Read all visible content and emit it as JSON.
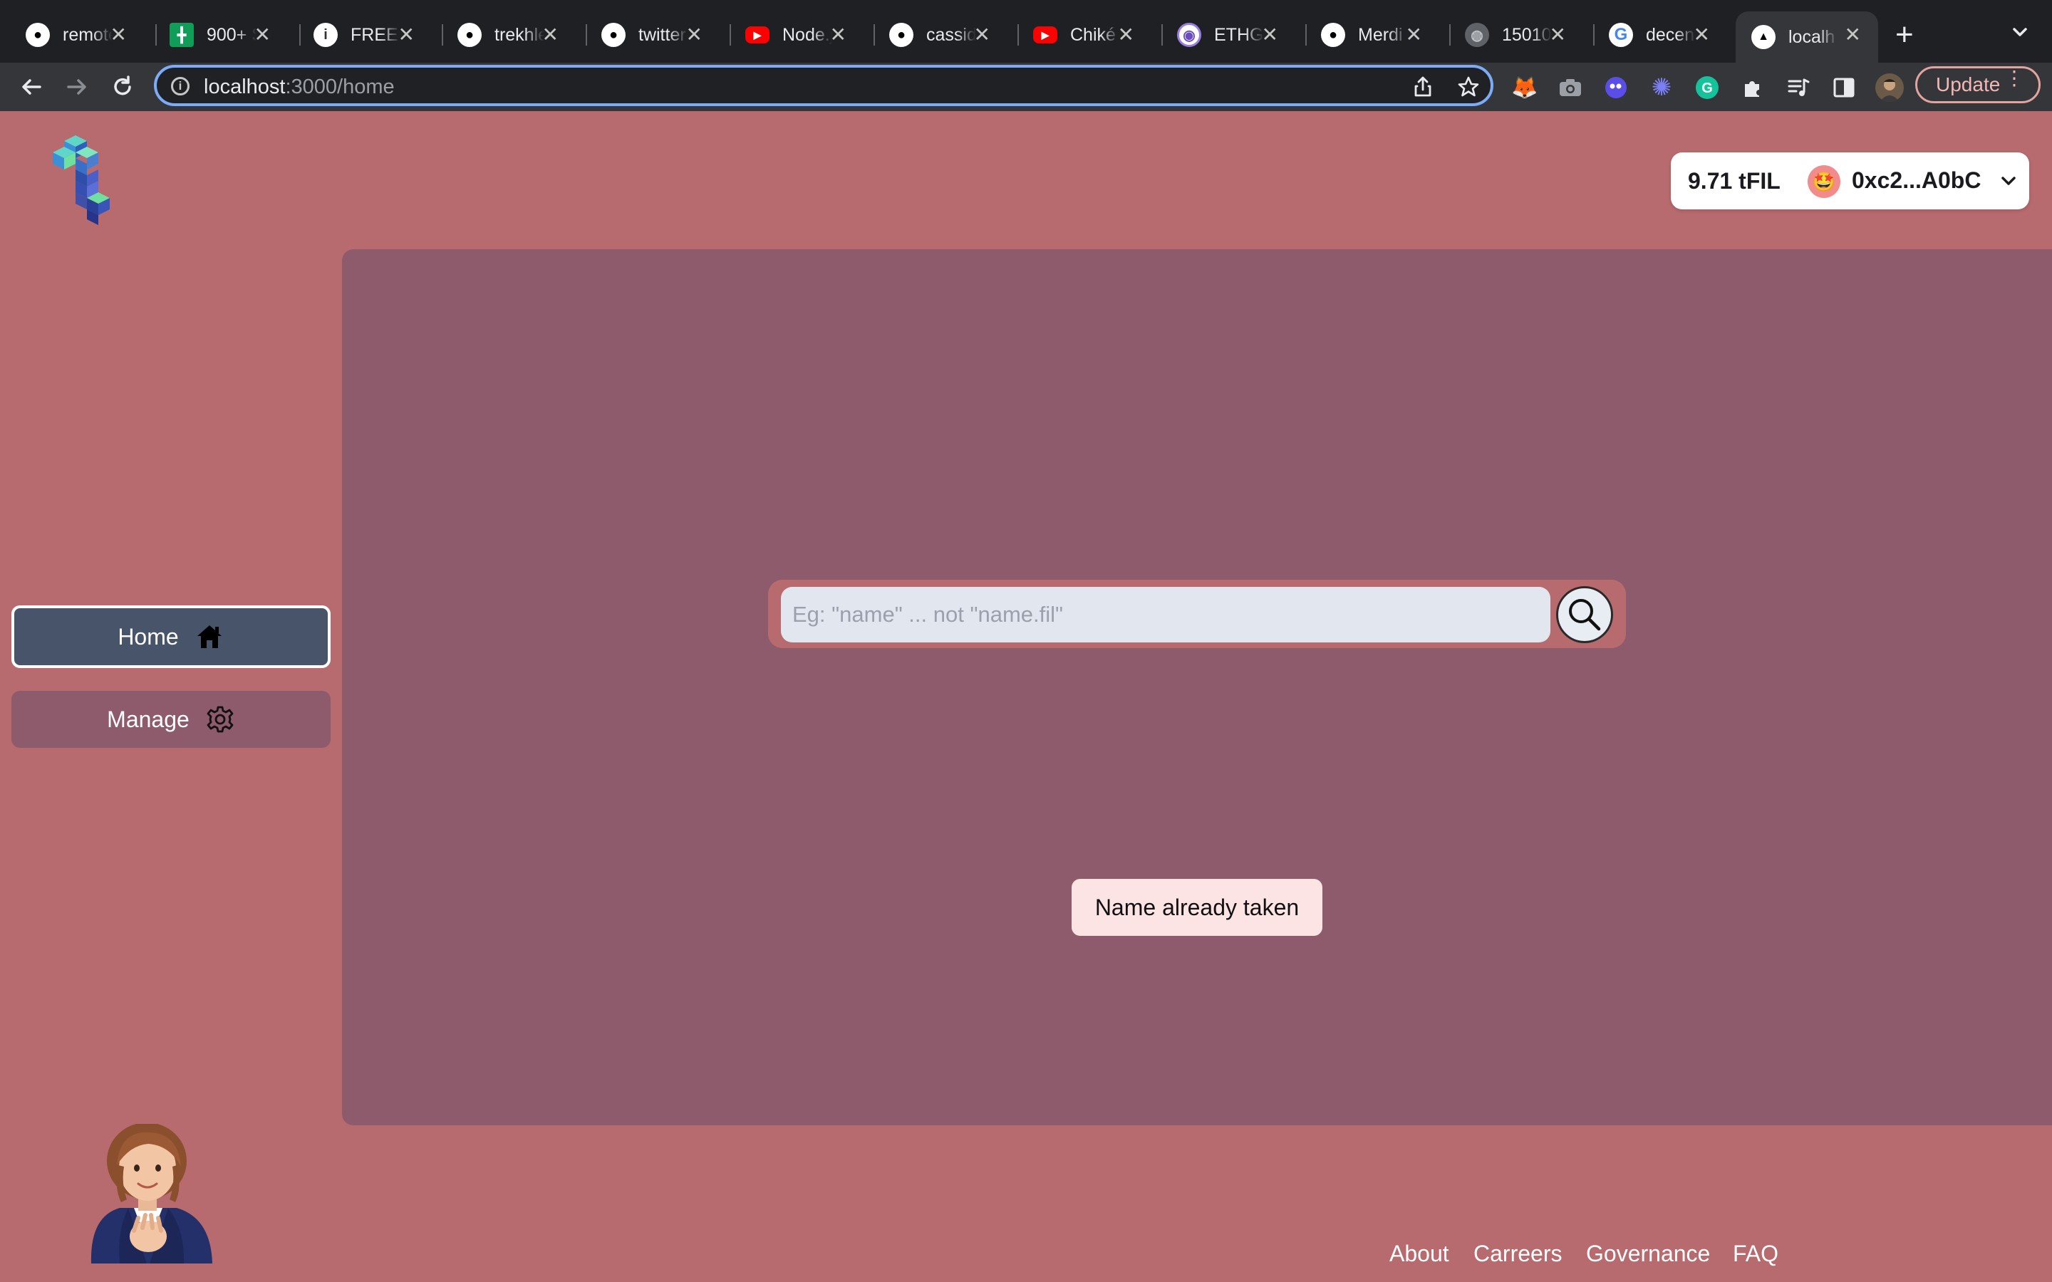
{
  "browser": {
    "tabs": [
      {
        "title": "remote",
        "icon": "github-icon"
      },
      {
        "title": "900+ S",
        "icon": "sheets-icon"
      },
      {
        "title": "FREE I",
        "icon": "info-icon"
      },
      {
        "title": "trekhle",
        "icon": "github-icon"
      },
      {
        "title": "twitter",
        "icon": "github-icon"
      },
      {
        "title": "Node.j",
        "icon": "youtube-icon"
      },
      {
        "title": "cassid",
        "icon": "github-icon"
      },
      {
        "title": "Chiké",
        "icon": "youtube-icon"
      },
      {
        "title": "ETHGl",
        "icon": "ethglobal-icon"
      },
      {
        "title": "Merdi",
        "icon": "github-icon"
      },
      {
        "title": "15010",
        "icon": "globe-icon"
      },
      {
        "title": "decen",
        "icon": "google-icon"
      },
      {
        "title": "localh",
        "icon": "vercel-icon",
        "active": true
      }
    ],
    "url_host": "localhost",
    "url_path": ":3000/home",
    "update_label": "Update"
  },
  "wallet": {
    "balance": "9.71 tFIL",
    "avatar": "🤩",
    "address": "0xc2...A0bC"
  },
  "search": {
    "placeholder": "Eg: \"name\" ... not \"name.fil\""
  },
  "toast": {
    "message": "Name already taken"
  },
  "sidebar": {
    "items": [
      {
        "label": "Home",
        "icon": "house-icon",
        "active": true
      },
      {
        "label": "Manage",
        "icon": "gear-icon",
        "active": false
      }
    ]
  },
  "footer": {
    "links": [
      "About",
      "Carreers",
      "Governance",
      "FAQ"
    ]
  },
  "colors": {
    "page_bg": "#b86b6e",
    "panel_bg": "#8d5b6b",
    "active_nav": "#48546a",
    "toast_bg": "#fde4e4"
  }
}
